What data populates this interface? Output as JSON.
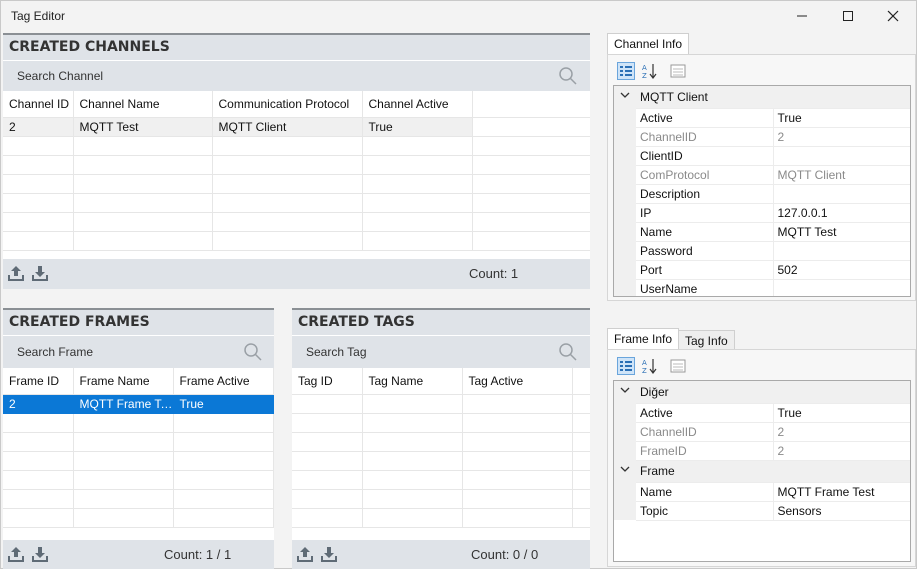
{
  "window": {
    "title": "Tag Editor"
  },
  "channels": {
    "header": "CREATED CHANNELS",
    "search_placeholder": "Search Channel",
    "columns": [
      "Channel ID",
      "Channel Name",
      "Communication Protocol",
      "Channel Active"
    ],
    "rows": [
      [
        "2",
        "MQTT Test",
        "MQTT Client",
        "True"
      ]
    ],
    "count": "Count: 1"
  },
  "frames": {
    "header": "CREATED FRAMES",
    "search_placeholder": "Search Frame",
    "columns": [
      "Frame ID",
      "Frame Name",
      "Frame Active"
    ],
    "rows": [
      [
        "2",
        "MQTT Frame Test",
        "True"
      ]
    ],
    "count": "Count: 1 / 1"
  },
  "tags": {
    "header": "CREATED TAGS",
    "search_placeholder": "Search Tag",
    "columns": [
      "Tag ID",
      "Tag Name",
      "Tag Active"
    ],
    "rows": [],
    "count": "Count: 0 / 0"
  },
  "channel_info": {
    "tab": "Channel Info",
    "category": "MQTT Client",
    "props": [
      {
        "name": "Active",
        "value": "True",
        "readonly": false
      },
      {
        "name": "ChannelID",
        "value": "2",
        "readonly": true
      },
      {
        "name": "ClientID",
        "value": "",
        "readonly": false
      },
      {
        "name": "ComProtocol",
        "value": "MQTT Client",
        "readonly": true
      },
      {
        "name": "Description",
        "value": "",
        "readonly": false
      },
      {
        "name": "IP",
        "value": "127.0.0.1",
        "readonly": false
      },
      {
        "name": "Name",
        "value": "MQTT Test",
        "readonly": false
      },
      {
        "name": "Password",
        "value": "",
        "readonly": false
      },
      {
        "name": "Port",
        "value": "502",
        "readonly": false
      },
      {
        "name": "UserName",
        "value": "",
        "readonly": false
      }
    ]
  },
  "frame_info": {
    "tabs": [
      "Frame Info",
      "Tag Info"
    ],
    "categories": [
      {
        "name": "Diğer",
        "props": [
          {
            "name": "Active",
            "value": "True",
            "readonly": false
          },
          {
            "name": "ChannelID",
            "value": "2",
            "readonly": true
          },
          {
            "name": "FrameID",
            "value": "2",
            "readonly": true
          }
        ]
      },
      {
        "name": "Frame",
        "props": [
          {
            "name": "Name",
            "value": "MQTT Frame Test",
            "readonly": false
          },
          {
            "name": "Topic",
            "value": "Sensors",
            "readonly": false
          }
        ]
      }
    ]
  }
}
